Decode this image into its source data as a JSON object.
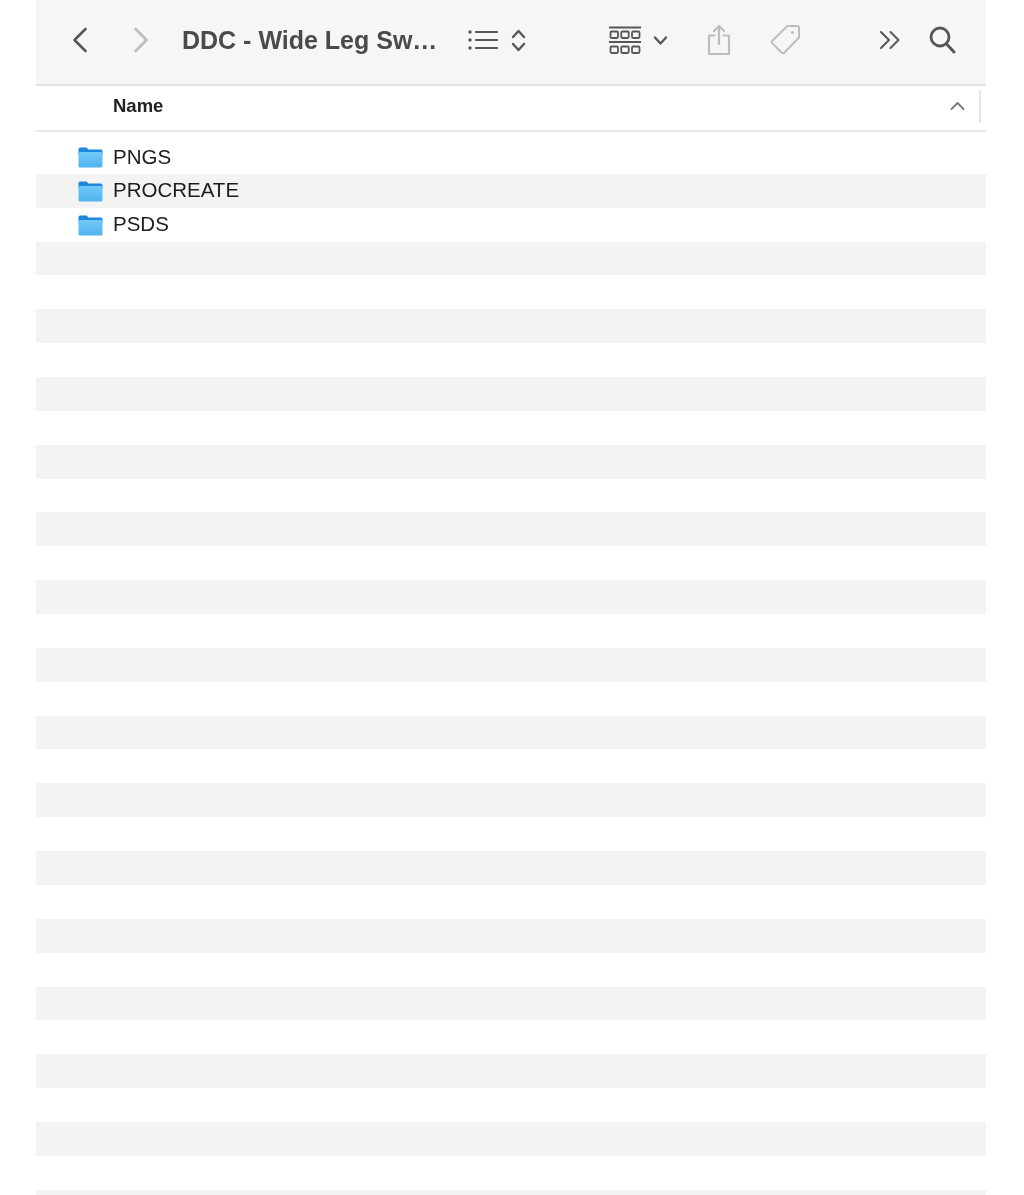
{
  "toolbar": {
    "back_button": {
      "disabled": false
    },
    "forward_button": {
      "disabled": true
    },
    "title": "DDC - Wide Leg Sw…",
    "share_button": {
      "disabled": true
    },
    "tag_button": {
      "disabled": true
    }
  },
  "table": {
    "columns": [
      {
        "label": "Name",
        "sort_ascending": true
      }
    ],
    "rows": [
      {
        "name": "PNGS",
        "selected": false
      },
      {
        "name": "PROCREATE",
        "selected": false
      },
      {
        "name": "PSDS",
        "selected": false
      }
    ]
  }
}
